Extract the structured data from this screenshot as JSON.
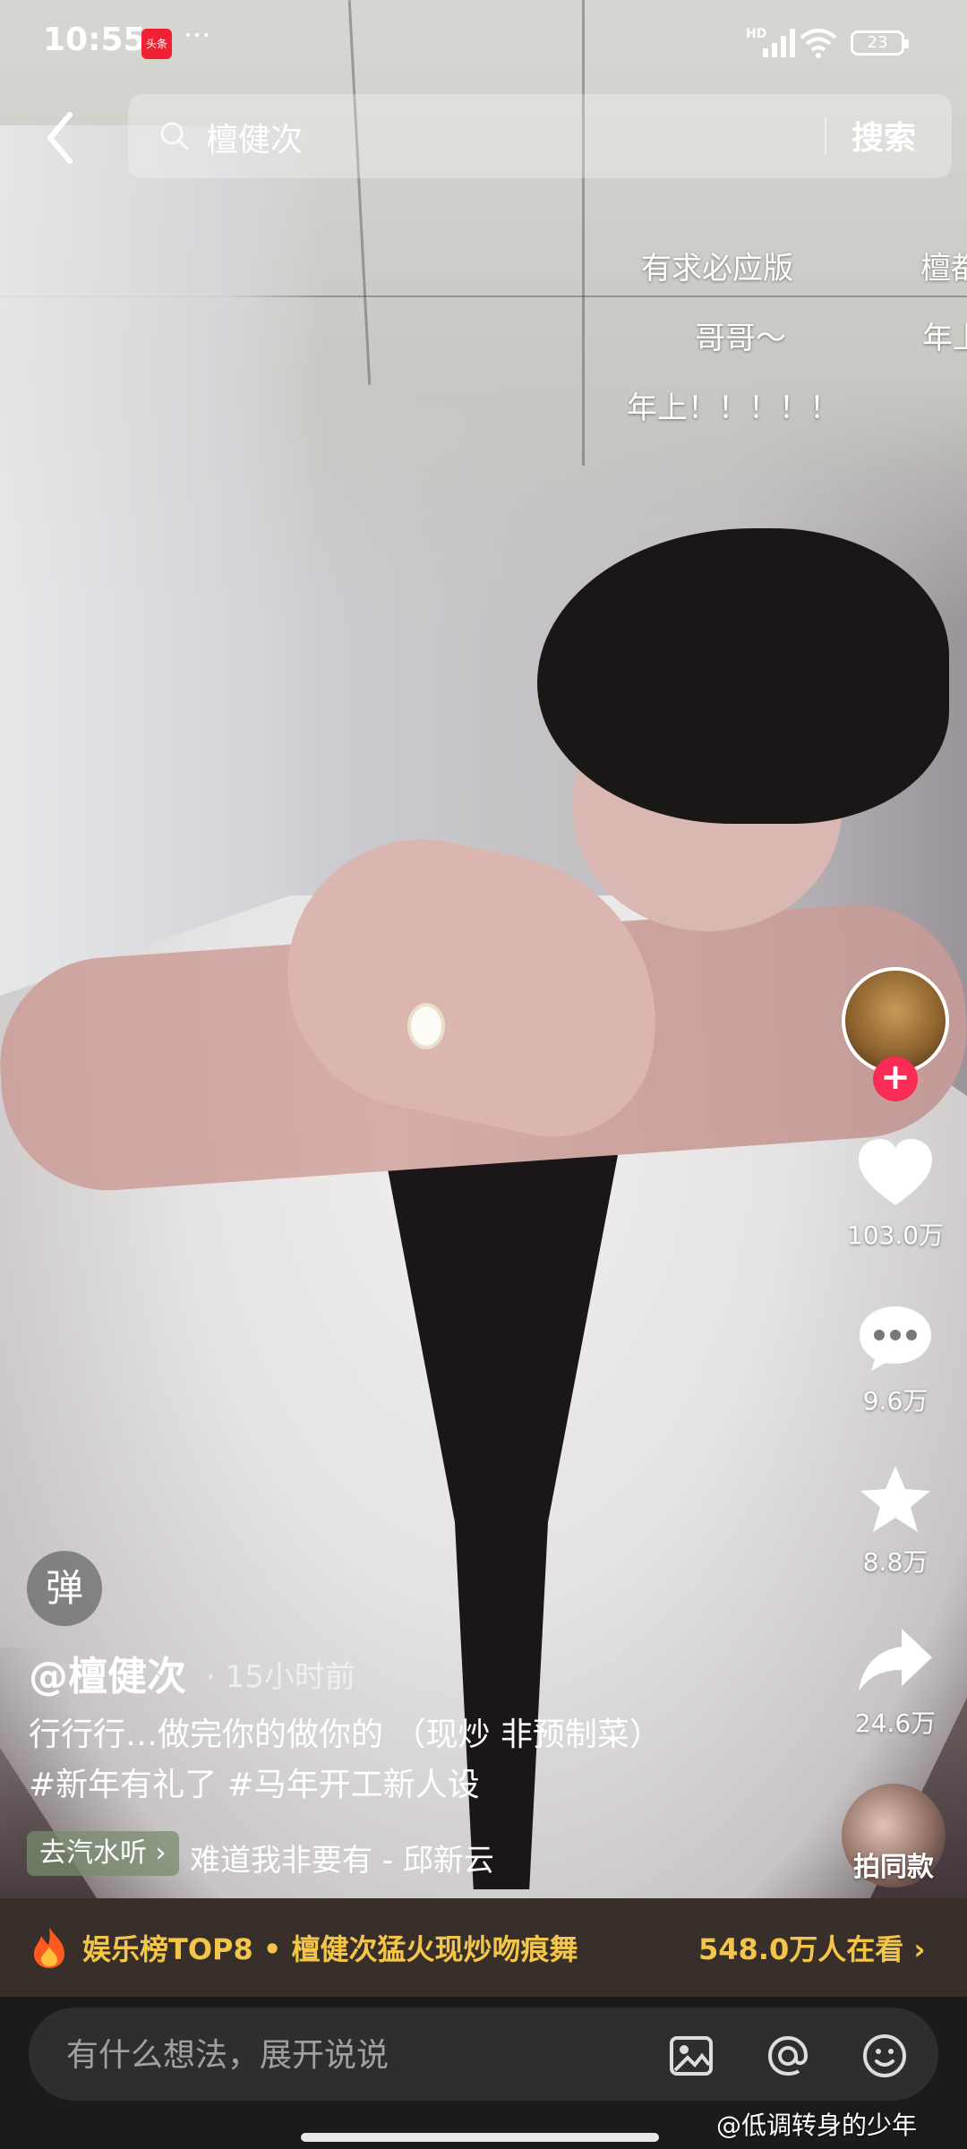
{
  "status_bar": {
    "time": "10:55",
    "app_badge": "头条",
    "more": "···",
    "network": "HD",
    "battery": "23"
  },
  "search": {
    "query": "檀健次",
    "button_label": "搜索"
  },
  "danmaku": [
    "有求必应版",
    "哥哥～",
    "年上！！！！！",
    "檀都",
    "年上"
  ],
  "video": {
    "author": "@檀健次",
    "time_ago": "· 15小时前",
    "caption_line1": "行行行…做完你的做你的 （现炒 非预制菜）",
    "caption_line2": "#新年有礼了 #马年开工新人设",
    "danmu_toggle": "弹",
    "music_chip": "去汽水听 ›",
    "music_title": "难道我非要有 - 邱新云"
  },
  "actions": {
    "likes": "103.0万",
    "comments": "9.6万",
    "favorites": "8.8万",
    "shares": "24.6万",
    "same_style": "拍同款",
    "follow": "+"
  },
  "trending": {
    "text": "娱乐榜TOP8 • 檀健次猛火现炒吻痕舞",
    "watching": "548.0万人在看 ›"
  },
  "comment": {
    "placeholder": "有什么想法，展开说说"
  },
  "watermark": "@低调转身的少年",
  "colors": {
    "accent_red": "#fa2c55",
    "trend_gold": "#f3c64a"
  },
  "icons": [
    "back-icon",
    "search-icon",
    "heart-icon",
    "comment-bubble-icon",
    "star-icon",
    "share-icon",
    "flame-icon",
    "image-icon",
    "at-icon",
    "emoji-icon"
  ]
}
